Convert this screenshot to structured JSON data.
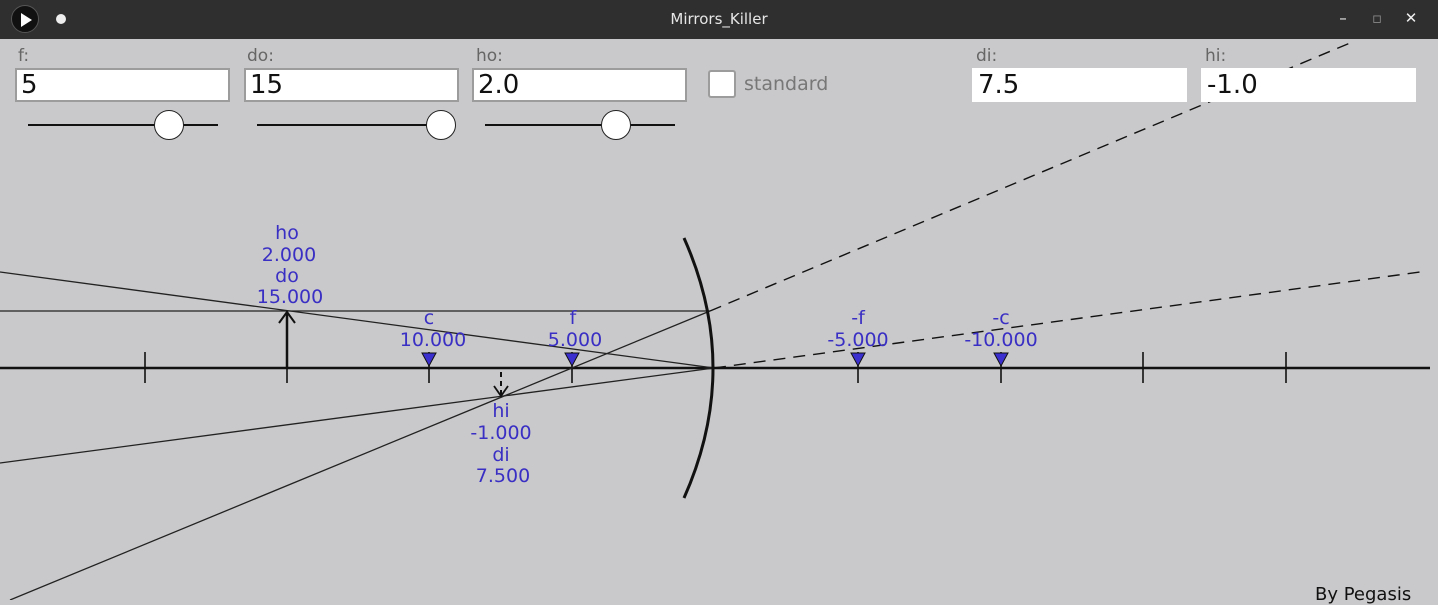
{
  "window": {
    "title": "Mirrors_Killer",
    "minimize_glyph": "–",
    "maximize_glyph": "▫",
    "close_glyph": "✕"
  },
  "inputs": {
    "f": {
      "label": "f:",
      "value": "5"
    },
    "do": {
      "label": "do:",
      "value": "15"
    },
    "ho": {
      "label": "ho:",
      "value": "2.0"
    }
  },
  "sliders": {
    "f": {
      "level": 0.74
    },
    "do": {
      "level": 0.97
    },
    "ho": {
      "level": 0.69
    }
  },
  "standard": {
    "label": "standard",
    "checked": false
  },
  "outputs": {
    "di": {
      "label": "di:",
      "value": "7.5"
    },
    "hi": {
      "label": "hi:",
      "value": "-1.0"
    }
  },
  "diagram": {
    "object_labels": [
      "ho",
      "2.000",
      "do",
      "15.000"
    ],
    "image_labels": [
      "hi",
      "-1.000",
      "di",
      "7.500"
    ],
    "markers": [
      {
        "name": "c",
        "value": "10.000"
      },
      {
        "name": "f",
        "value": "5.000"
      },
      {
        "name": "-f",
        "value": "-5.000"
      },
      {
        "name": "-c",
        "value": "-10.000"
      }
    ],
    "label_color": "#3a2fc4",
    "marker_color": "#3b2fd0"
  },
  "credit": "By Pegasis"
}
